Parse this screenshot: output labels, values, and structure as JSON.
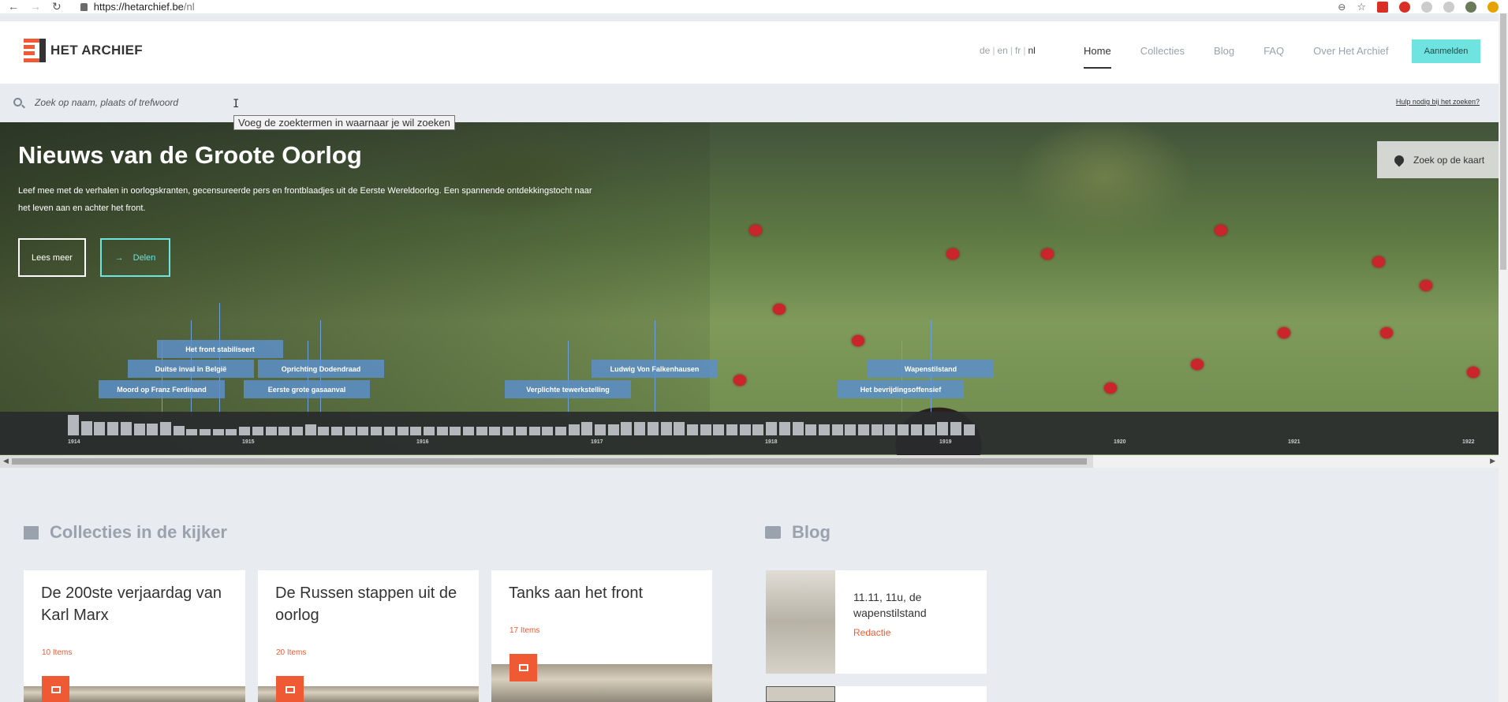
{
  "browser": {
    "url_host": "https://hetarchief.be",
    "url_path": "/nl"
  },
  "header": {
    "logo_text": "HET ARCHIEF",
    "languages": [
      "de",
      "en",
      "fr",
      "nl"
    ],
    "active_language": "nl",
    "nav": [
      "Home",
      "Collecties",
      "Blog",
      "FAQ",
      "Over Het Archief"
    ],
    "active_nav": "Home",
    "login_label": "Aanmelden"
  },
  "search": {
    "placeholder": "Zoek op naam, plaats of trefwoord",
    "tooltip": "Voeg de zoektermen in waarnaar je wil zoeken",
    "help_link": "Hulp nodig bij het zoeken?"
  },
  "hero": {
    "title": "Nieuws van de Groote Oorlog",
    "text": "Leef mee met de verhalen in oorlogskranten, gecensureerde pers en frontblaadjes uit de Eerste Wereldoorlog. Een spannende ontdekkingstocht naar het leven aan en achter het front.",
    "read_more": "Lees meer",
    "share": "Delen",
    "map_button": "Zoek op de kaart"
  },
  "timeline": {
    "years": [
      "1914",
      "1915",
      "1916",
      "1917",
      "1918",
      "1919",
      "1920",
      "1921",
      "1922"
    ],
    "events": [
      "Het front stabiliseert",
      "Duitse inval in België",
      "Oprichting Dodendraad",
      "Moord op Franz Ferdinand",
      "Eerste grote gasaanval",
      "Verplichte tewerkstelling",
      "Ludwig Von Falkenhausen",
      "Wapenstilstand",
      "Het bevrijdingsoffensief"
    ]
  },
  "collections": {
    "title": "Collecties in de kijker",
    "cards": [
      {
        "title": "De 200ste verjaardag van Karl Marx",
        "count": "10 Items"
      },
      {
        "title": "De Russen stappen uit de oorlog",
        "count": "20 Items"
      },
      {
        "title": "Tanks aan het front",
        "count": "17 Items"
      }
    ]
  },
  "blog": {
    "title": "Blog",
    "posts": [
      {
        "title": "11.11, 11u, de wapenstilstand",
        "author": "Redactie"
      }
    ]
  },
  "colors": {
    "accent": "#ef5a34",
    "teal": "#6ee3df",
    "event_blue": "#5c8fc9"
  }
}
